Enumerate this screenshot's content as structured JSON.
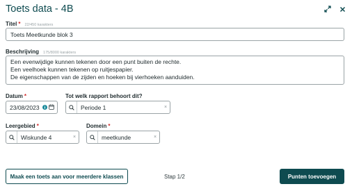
{
  "dialog": {
    "title": "Toets data - 4B",
    "expand_icon": "expand-icon",
    "close_icon": "close-icon"
  },
  "fields": {
    "titel": {
      "label": "Titel",
      "required_mark": "*",
      "counter": "22/450 karakters",
      "value": "Toets Meetkunde blok 3"
    },
    "beschrijving": {
      "label": "Beschrijving",
      "counter": "175/8000 karakters",
      "lines": [
        "Een evenwijdige kunnen tekenen door een punt buiten de rechte.",
        "Een veelhoek kunnen tekenen op ruitjespapier.",
        "De eigenschappen van de zijden en hoeken bij vierhoeken aanduiden."
      ]
    },
    "datum": {
      "label": "Datum",
      "required_mark": "*",
      "value": "23/08/2023"
    },
    "rapport": {
      "label": "Tot welk rapport behoort dit?",
      "value": "Periode 1",
      "clear": "×"
    },
    "leergebied": {
      "label": "Leergebied",
      "required_mark": "*",
      "value": "Wiskunde 4",
      "clear": "×"
    },
    "domein": {
      "label": "Domein",
      "required_mark": "*",
      "value": "meetkunde",
      "clear": "×"
    }
  },
  "footer": {
    "multi_class_button": "Maak een toets aan voor meerdere klassen",
    "step_text": "Stap 1/2",
    "next_button": "Punten toevoegen"
  },
  "colors": {
    "primary": "#0e4b50",
    "required": "#d22a2a",
    "border": "#9aa3a6",
    "info": "#1a8a9a"
  }
}
